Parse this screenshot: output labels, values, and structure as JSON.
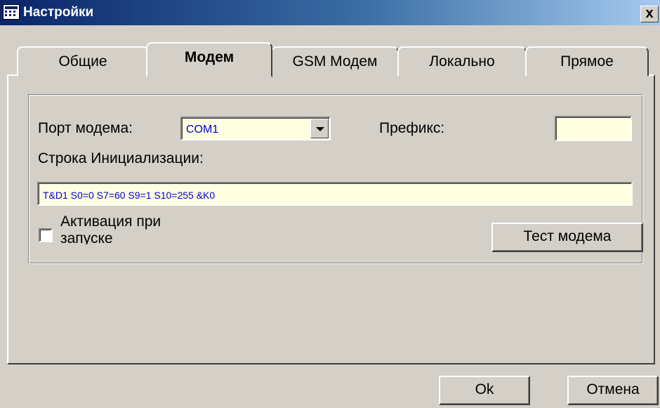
{
  "window": {
    "title": "Настройки",
    "close_label": "x"
  },
  "tabs": [
    {
      "label": "Общие"
    },
    {
      "label": "Модем",
      "active": true
    },
    {
      "label": "GSM Модем"
    },
    {
      "label": "Локально"
    },
    {
      "label": "Прямое"
    }
  ],
  "modem": {
    "port_label": "Порт модема:",
    "port_value": "COM1",
    "prefix_label": "Префикс:",
    "prefix_value": "",
    "init_label": "Строка Инициализации:",
    "init_value": "T&D1 S0=0 S7=60 S9=1 S10=255 &K0",
    "activate_label": "Активация при запуске",
    "activate_checked": false,
    "test_button": "Тест модема"
  },
  "buttons": {
    "ok": "Ok",
    "cancel": "Отмена"
  },
  "colors": {
    "titlebar_start": "#0a246a",
    "input_bg": "#ffffe1",
    "value_text": "#0000cc"
  }
}
